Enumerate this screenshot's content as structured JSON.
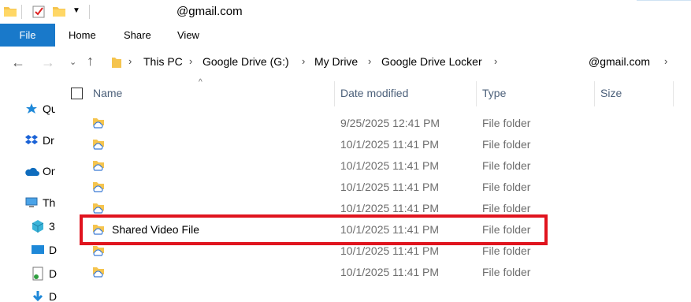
{
  "titlebar": {
    "title": "@gmail.com",
    "qat_icons": [
      "folder-icon",
      "properties-check-icon",
      "new-folder-icon",
      "customize-dropdown-icon"
    ]
  },
  "ribbon": {
    "file_tab": "File",
    "tabs": [
      "Home",
      "Share",
      "View"
    ]
  },
  "address": {
    "breadcrumbs": [
      "This PC",
      "Google Drive (G:)",
      "My Drive",
      "Google Drive Locker",
      "@gmail.com"
    ]
  },
  "nav_pane": {
    "items": [
      {
        "label": "Qu",
        "icon": "quick-access-star-icon"
      },
      {
        "label": "Dr",
        "icon": "dropbox-icon"
      },
      {
        "label": "On",
        "icon": "onedrive-cloud-icon"
      },
      {
        "label": "Th",
        "icon": "this-pc-icon"
      },
      {
        "label": "3",
        "icon": "3d-objects-icon"
      },
      {
        "label": "D",
        "icon": "desktop-icon"
      },
      {
        "label": "D",
        "icon": "documents-icon"
      },
      {
        "label": "D",
        "icon": "downloads-icon"
      }
    ]
  },
  "columns": {
    "name": "Name",
    "date": "Date modified",
    "type": "Type",
    "size": "Size"
  },
  "files": [
    {
      "name": "",
      "date": "9/25/2025 12:41 PM",
      "type": "File folder"
    },
    {
      "name": "",
      "date": "10/1/2025 11:41 PM",
      "type": "File folder"
    },
    {
      "name": "",
      "date": "10/1/2025 11:41 PM",
      "type": "File folder"
    },
    {
      "name": "",
      "date": "10/1/2025 11:41 PM",
      "type": "File folder"
    },
    {
      "name": "",
      "date": "10/1/2025 11:41 PM",
      "type": "File folder"
    },
    {
      "name": "Shared Video File",
      "date": "10/1/2025 11:41 PM",
      "type": "File folder"
    },
    {
      "name": "",
      "date": "10/1/2025 11:41 PM",
      "type": "File folder"
    },
    {
      "name": "",
      "date": "10/1/2025 11:41 PM",
      "type": "File folder"
    }
  ],
  "colors": {
    "file_tab": "#1979ca",
    "highlight_border": "#e0141e",
    "header_text": "#4c607a",
    "meta_text": "#6d6d6d"
  }
}
